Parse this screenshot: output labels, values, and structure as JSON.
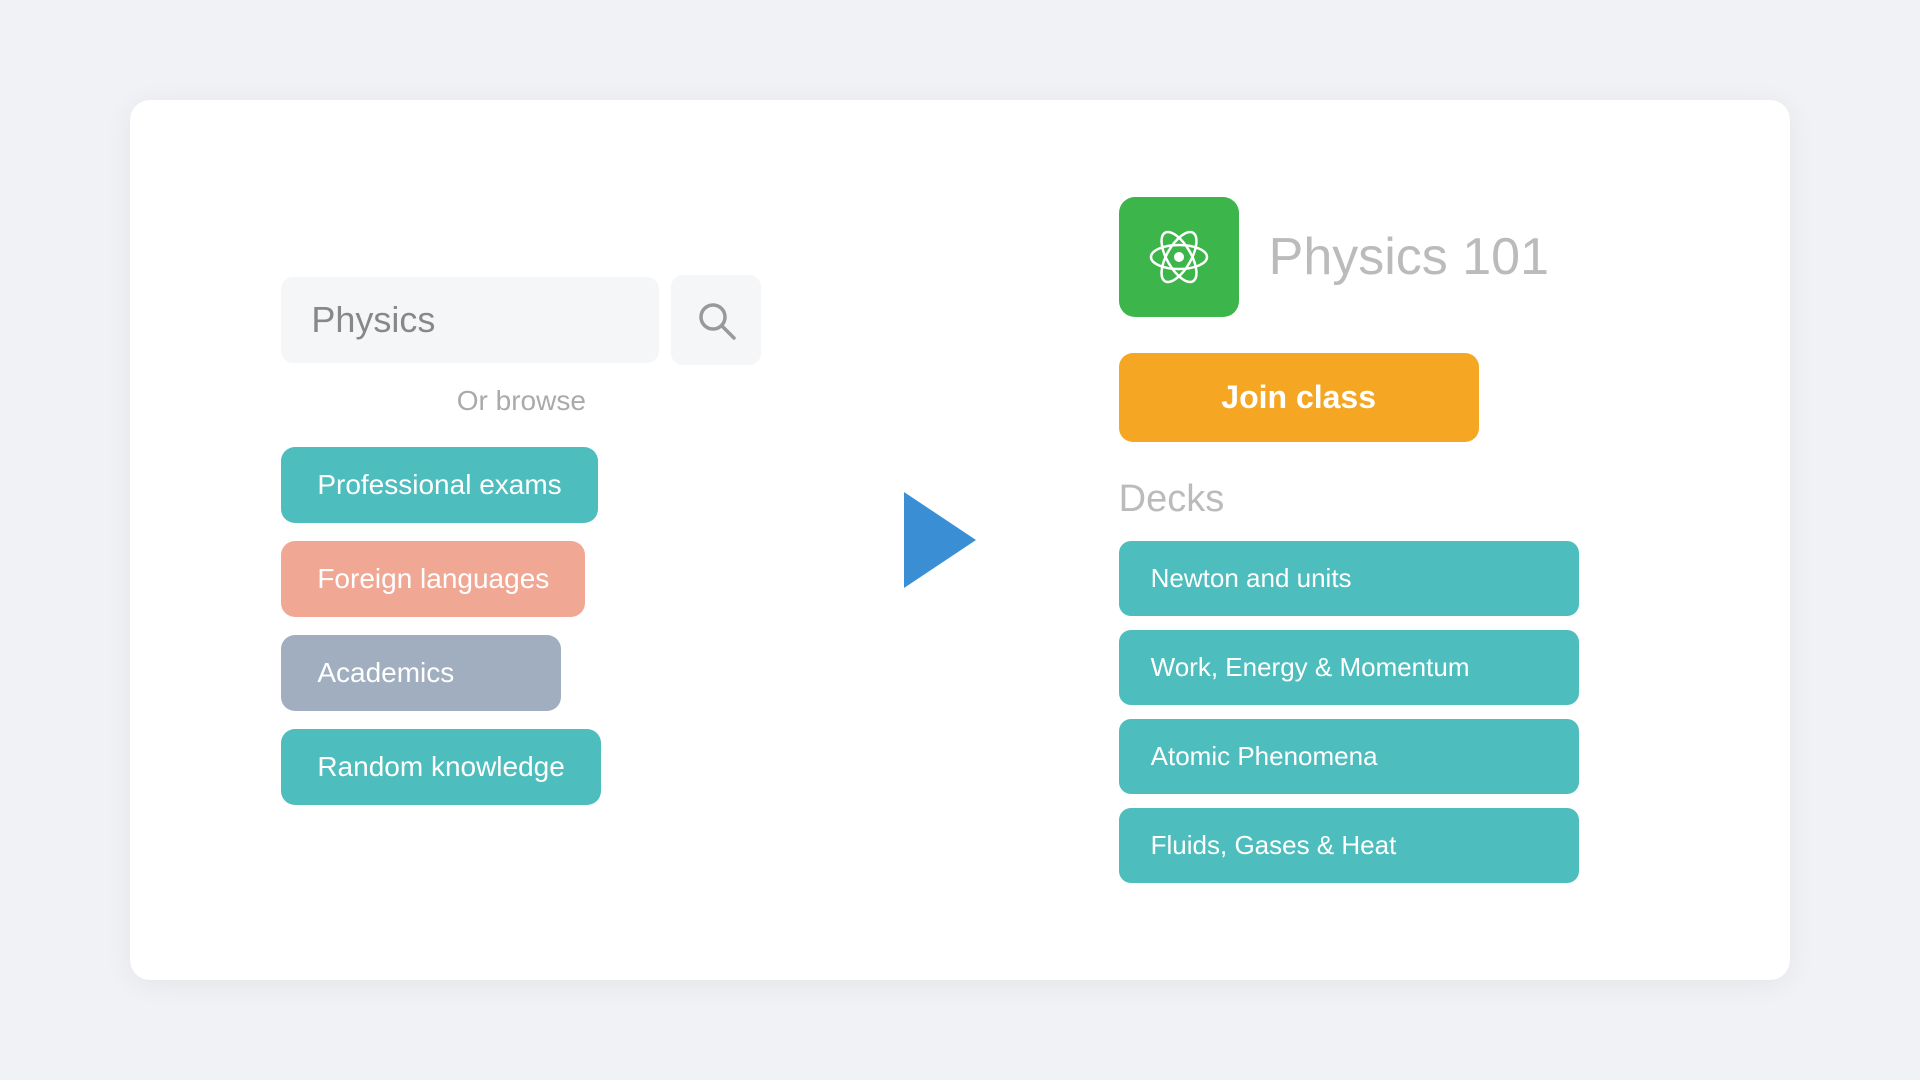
{
  "left": {
    "search_placeholder": "Physics",
    "search_icon_label": "search",
    "or_browse": "Or browse",
    "categories": [
      {
        "label": "Professional exams",
        "color": "teal"
      },
      {
        "label": "Foreign languages",
        "color": "peach"
      },
      {
        "label": "Academics",
        "color": "lavender"
      },
      {
        "label": "Random knowledge",
        "color": "teal2"
      }
    ]
  },
  "right": {
    "class_name": "Physics 101",
    "join_label": "Join class",
    "decks_label": "Decks",
    "decks": [
      {
        "label": "Newton and units"
      },
      {
        "label": "Work, Energy & Momentum"
      },
      {
        "label": "Atomic Phenomena"
      },
      {
        "label": "Fluids, Gases & Heat"
      }
    ]
  },
  "colors": {
    "teal": "#4dbdbd",
    "peach": "#f0a894",
    "lavender": "#a0aec0",
    "orange": "#f5a623",
    "green": "#3cb54a",
    "arrow_blue": "#3a8fd4"
  }
}
